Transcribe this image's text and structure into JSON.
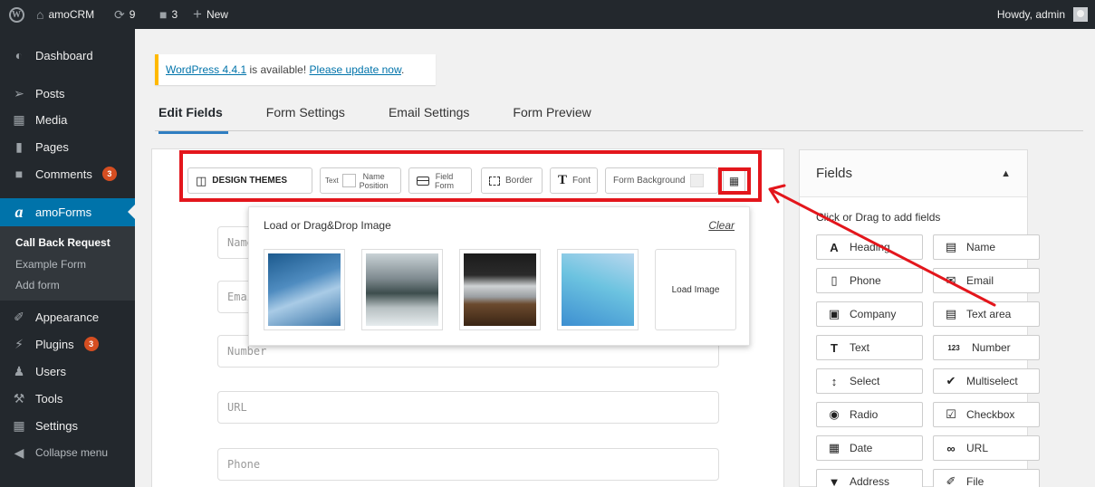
{
  "adminbar": {
    "site_name": "amoCRM",
    "updates_count": "9",
    "comments_count": "3",
    "new_label": "New",
    "howdy": "Howdy, admin"
  },
  "sidebar": {
    "items": [
      {
        "label": "Dashboard",
        "icon": "dashboard-icon"
      },
      {
        "label": "Posts",
        "icon": "pin-icon"
      },
      {
        "label": "Media",
        "icon": "media-icon"
      },
      {
        "label": "Pages",
        "icon": "pages-icon"
      },
      {
        "label": "Comments",
        "icon": "comment-icon",
        "badge": "3"
      },
      {
        "label": "amoForms",
        "icon": "amoforms-icon"
      },
      {
        "label": "Appearance",
        "icon": "brush-icon"
      },
      {
        "label": "Plugins",
        "icon": "plug-icon",
        "badge": "3"
      },
      {
        "label": "Users",
        "icon": "users-icon"
      },
      {
        "label": "Tools",
        "icon": "wrench-icon"
      },
      {
        "label": "Settings",
        "icon": "settings-icon"
      },
      {
        "label": "Collapse menu",
        "icon": "collapse-icon"
      }
    ],
    "submenu": [
      "Call Back Request",
      "Example Form",
      "Add form"
    ]
  },
  "notice": {
    "link1": "WordPress 4.4.1",
    "mid": " is available! ",
    "link2": "Please update now",
    "end": "."
  },
  "tabs": [
    "Edit Fields",
    "Form Settings",
    "Email Settings",
    "Form Preview"
  ],
  "toolbar": {
    "design_themes": "DESIGN THEMES",
    "text_label": "Text",
    "name_position_1": "Name",
    "name_position_2": "Position",
    "field_form_1": "Field",
    "field_form_2": "Form",
    "border": "Border",
    "font": "Font",
    "form_background": "Form Background"
  },
  "dropdown": {
    "title": "Load or Drag&Drop Image",
    "clear": "Clear",
    "load_image": "Load Image"
  },
  "form_fields": [
    "Name",
    "Email",
    "Number",
    "URL",
    "Phone"
  ],
  "fields_panel": {
    "title": "Fields",
    "hint": "Click or Drag to add fields",
    "buttons": [
      {
        "label": "Heading",
        "icon": "heading-icon",
        "glyph": "A"
      },
      {
        "label": "Name",
        "icon": "id-card-icon",
        "glyph": "▤"
      },
      {
        "label": "Phone",
        "icon": "phone-icon",
        "glyph": "▯"
      },
      {
        "label": "Email",
        "icon": "envelope-icon",
        "glyph": "✉"
      },
      {
        "label": "Company",
        "icon": "briefcase-icon",
        "glyph": "▣"
      },
      {
        "label": "Text area",
        "icon": "textarea-icon",
        "glyph": "▤"
      },
      {
        "label": "Text",
        "icon": "text-icon",
        "glyph": "T"
      },
      {
        "label": "Number",
        "icon": "number-icon",
        "glyph": "123"
      },
      {
        "label": "Select",
        "icon": "select-icon",
        "glyph": "↕"
      },
      {
        "label": "Multiselect",
        "icon": "multiselect-icon",
        "glyph": "✔"
      },
      {
        "label": "Radio",
        "icon": "radio-icon",
        "glyph": "◉"
      },
      {
        "label": "Checkbox",
        "icon": "checkbox-icon",
        "glyph": "☑"
      },
      {
        "label": "Date",
        "icon": "calendar-icon",
        "glyph": "▦"
      },
      {
        "label": "URL",
        "icon": "link-icon",
        "glyph": "∞"
      },
      {
        "label": "Address",
        "icon": "map-pin-icon",
        "glyph": "▼"
      },
      {
        "label": "File",
        "icon": "paperclip-icon",
        "glyph": "✐"
      }
    ]
  },
  "colors": {
    "adminbar": "#23282d",
    "accent": "#0073aa",
    "annotation": "#e3161c"
  }
}
